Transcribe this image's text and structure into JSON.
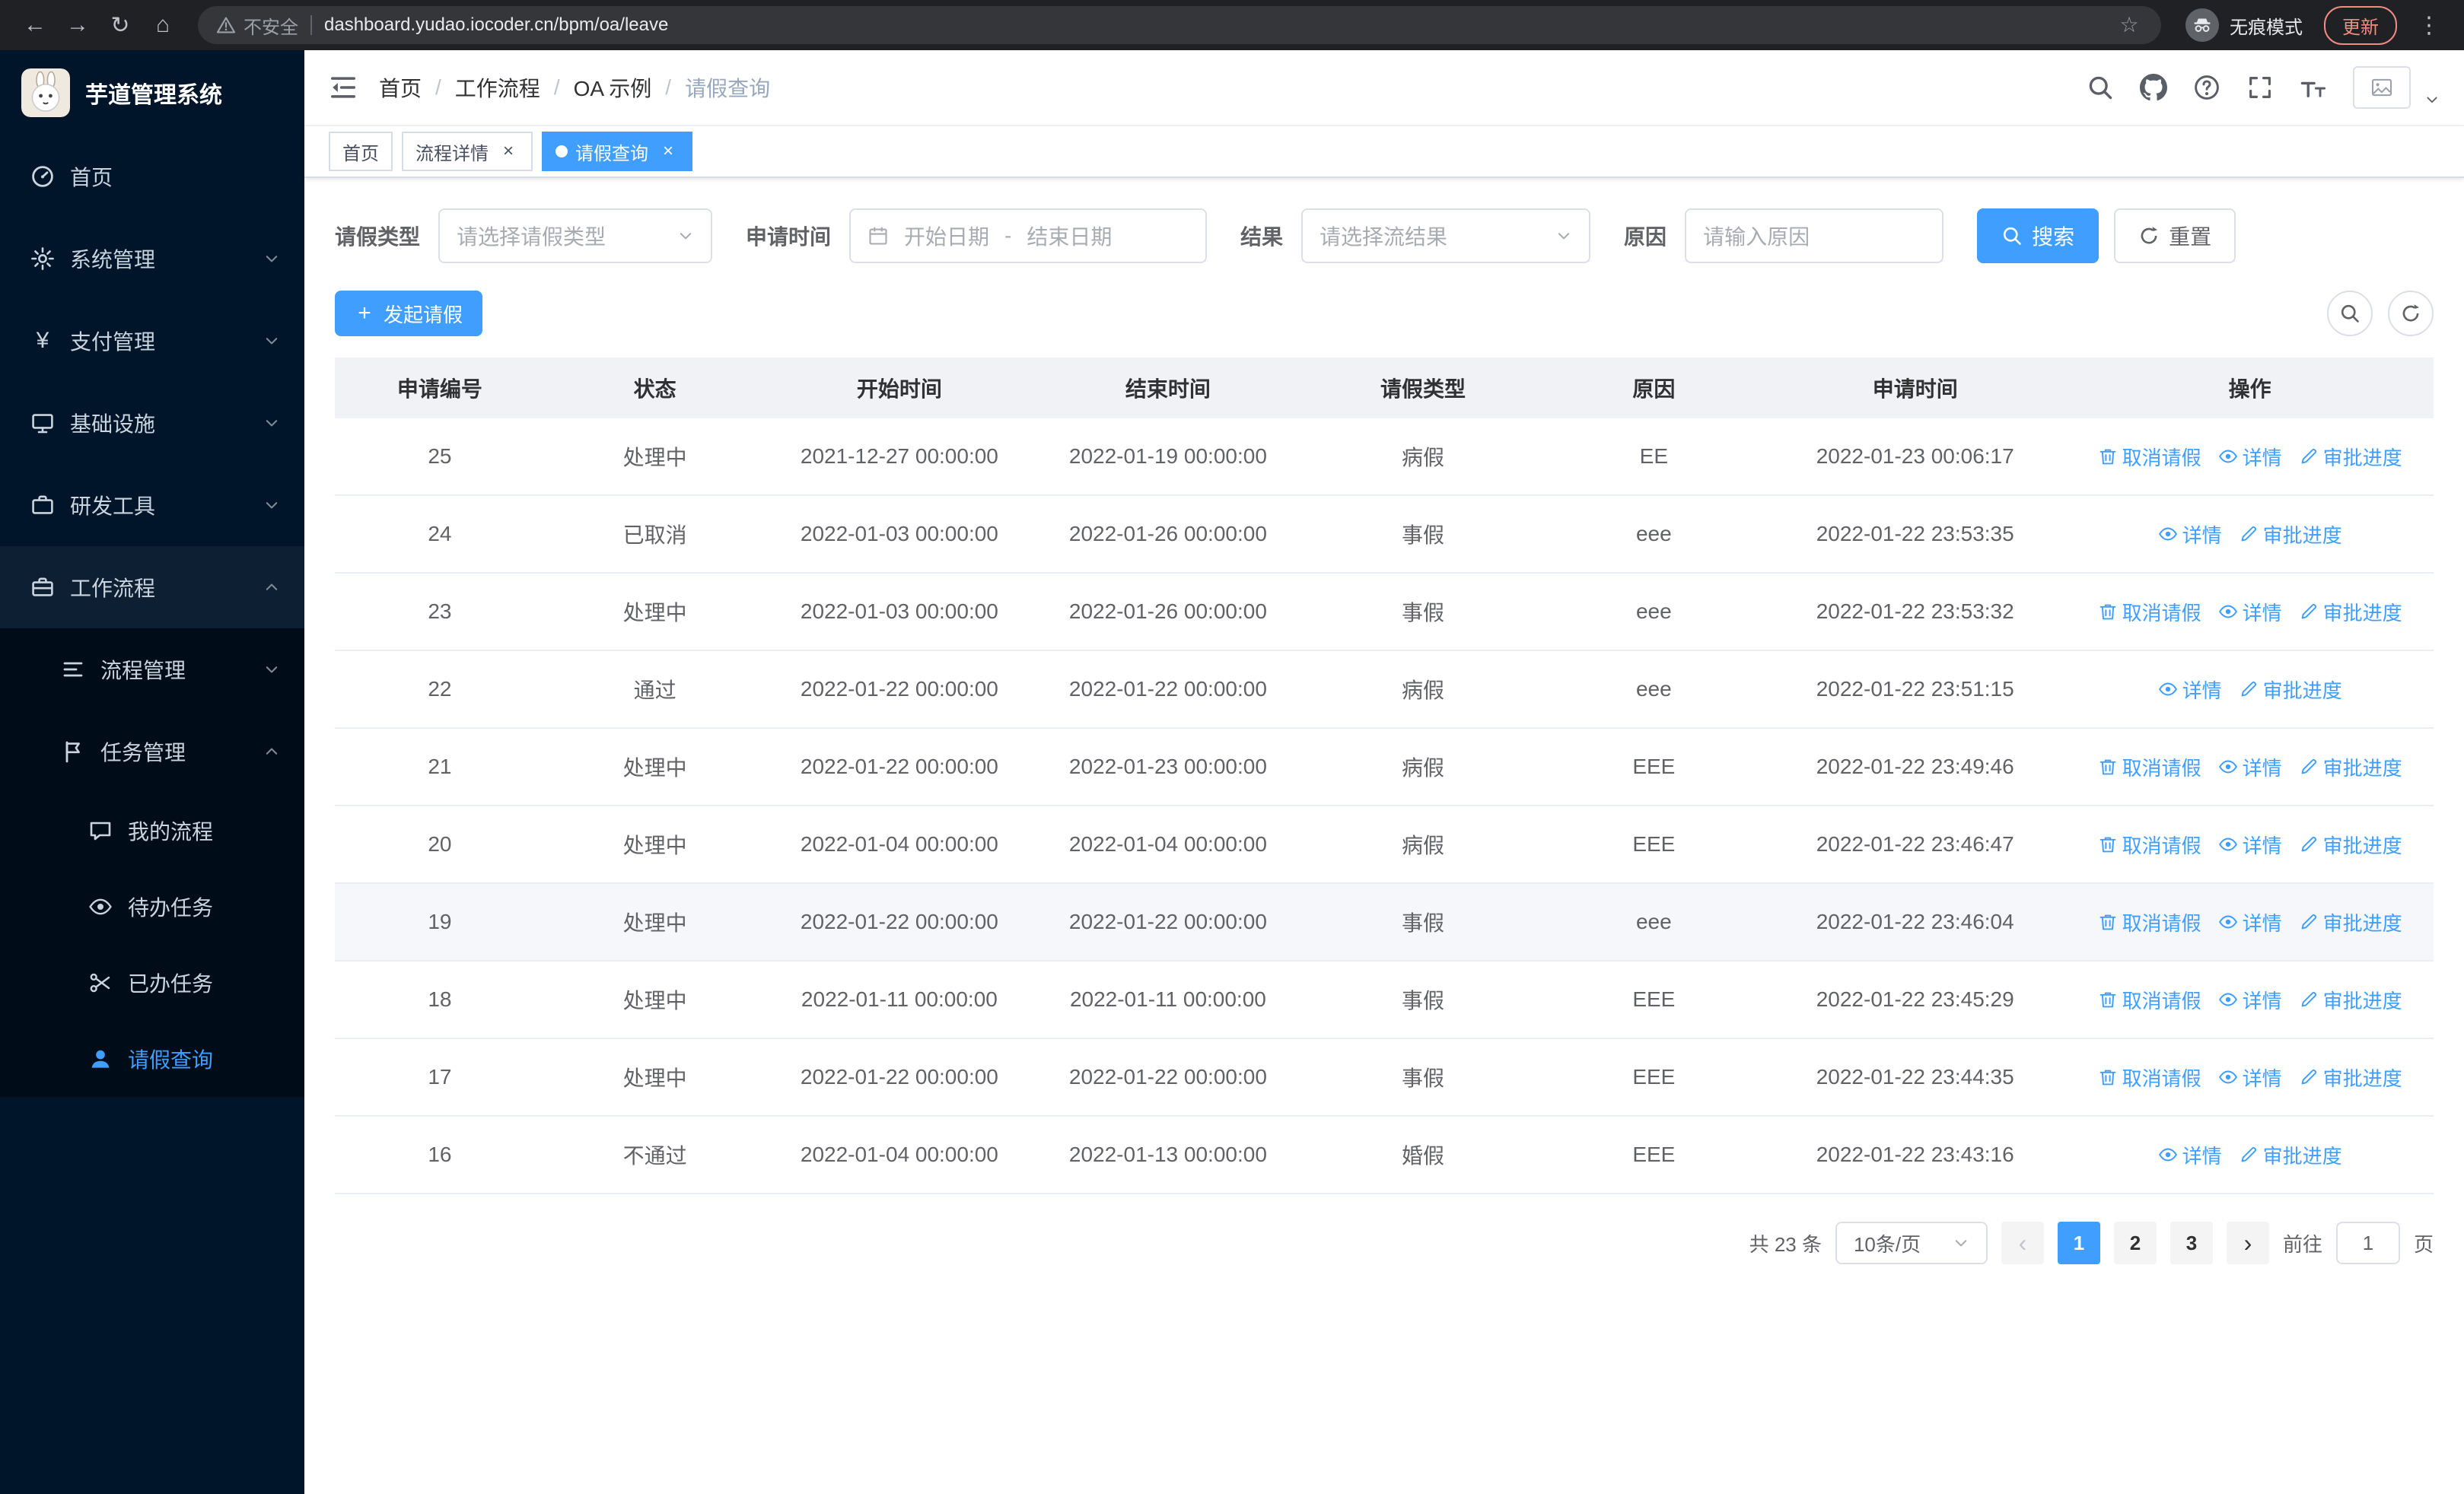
{
  "browser": {
    "security_warning": "不安全",
    "url": "dashboard.yudao.iocoder.cn/bpm/oa/leave",
    "incognito_label": "无痕模式",
    "update_label": "更新"
  },
  "sidebar": {
    "title": "芋道管理系统",
    "menu": [
      {
        "label": "首页",
        "icon": "dashboard",
        "level": 1
      },
      {
        "label": "系统管理",
        "icon": "gear",
        "level": 1,
        "arrow": "down"
      },
      {
        "label": "支付管理",
        "icon": "yen",
        "level": 1,
        "arrow": "down"
      },
      {
        "label": "基础设施",
        "icon": "monitor",
        "level": 1,
        "arrow": "down"
      },
      {
        "label": "研发工具",
        "icon": "toolbox",
        "level": 1,
        "arrow": "down"
      },
      {
        "label": "工作流程",
        "icon": "suitcase",
        "level": 1,
        "arrow": "up",
        "open": true
      },
      {
        "label": "流程管理",
        "icon": "stream",
        "level": 2,
        "arrow": "down"
      },
      {
        "label": "任务管理",
        "icon": "flag",
        "level": 2,
        "arrow": "up",
        "open": true
      },
      {
        "label": "我的流程",
        "icon": "chat",
        "level": 3
      },
      {
        "label": "待办任务",
        "icon": "eye",
        "level": 3
      },
      {
        "label": "已办任务",
        "icon": "scissors",
        "level": 3
      },
      {
        "label": "请假查询",
        "icon": "user",
        "level": 3,
        "active": true
      }
    ]
  },
  "header": {
    "breadcrumb": [
      "首页",
      "工作流程",
      "OA 示例",
      "请假查询"
    ]
  },
  "tabs": [
    {
      "label": "首页",
      "closable": false,
      "active": false
    },
    {
      "label": "流程详情",
      "closable": true,
      "active": false
    },
    {
      "label": "请假查询",
      "closable": true,
      "active": true
    }
  ],
  "filters": {
    "leave_type_label": "请假类型",
    "leave_type_placeholder": "请选择请假类型",
    "apply_time_label": "申请时间",
    "start_date_placeholder": "开始日期",
    "date_separator": "-",
    "end_date_placeholder": "结束日期",
    "result_label": "结果",
    "result_placeholder": "请选择流结果",
    "reason_label": "原因",
    "reason_placeholder": "请输入原因",
    "search_button": "搜索",
    "reset_button": "重置"
  },
  "toolbar": {
    "create_button": "发起请假"
  },
  "table": {
    "columns": [
      "申请编号",
      "状态",
      "开始时间",
      "结束时间",
      "请假类型",
      "原因",
      "申请时间",
      "操作"
    ],
    "action_labels": {
      "cancel": "取消请假",
      "detail": "详情",
      "progress": "审批进度"
    },
    "rows": [
      {
        "id": "25",
        "status": "处理中",
        "start": "2021-12-27 00:00:00",
        "end": "2022-01-19 00:00:00",
        "type": "病假",
        "reason": "EE",
        "applied": "2022-01-23 00:06:17",
        "actions": [
          "cancel",
          "detail",
          "progress"
        ]
      },
      {
        "id": "24",
        "status": "已取消",
        "start": "2022-01-03 00:00:00",
        "end": "2022-01-26 00:00:00",
        "type": "事假",
        "reason": "eee",
        "applied": "2022-01-22 23:53:35",
        "actions": [
          "detail",
          "progress"
        ]
      },
      {
        "id": "23",
        "status": "处理中",
        "start": "2022-01-03 00:00:00",
        "end": "2022-01-26 00:00:00",
        "type": "事假",
        "reason": "eee",
        "applied": "2022-01-22 23:53:32",
        "actions": [
          "cancel",
          "detail",
          "progress"
        ]
      },
      {
        "id": "22",
        "status": "通过",
        "start": "2022-01-22 00:00:00",
        "end": "2022-01-22 00:00:00",
        "type": "病假",
        "reason": "eee",
        "applied": "2022-01-22 23:51:15",
        "actions": [
          "detail",
          "progress"
        ]
      },
      {
        "id": "21",
        "status": "处理中",
        "start": "2022-01-22 00:00:00",
        "end": "2022-01-23 00:00:00",
        "type": "病假",
        "reason": "EEE",
        "applied": "2022-01-22 23:49:46",
        "actions": [
          "cancel",
          "detail",
          "progress"
        ]
      },
      {
        "id": "20",
        "status": "处理中",
        "start": "2022-01-04 00:00:00",
        "end": "2022-01-04 00:00:00",
        "type": "病假",
        "reason": "EEE",
        "applied": "2022-01-22 23:46:47",
        "actions": [
          "cancel",
          "detail",
          "progress"
        ]
      },
      {
        "id": "19",
        "status": "处理中",
        "start": "2022-01-22 00:00:00",
        "end": "2022-01-22 00:00:00",
        "type": "事假",
        "reason": "eee",
        "applied": "2022-01-22 23:46:04",
        "actions": [
          "cancel",
          "detail",
          "progress"
        ],
        "hover": true
      },
      {
        "id": "18",
        "status": "处理中",
        "start": "2022-01-11 00:00:00",
        "end": "2022-01-11 00:00:00",
        "type": "事假",
        "reason": "EEE",
        "applied": "2022-01-22 23:45:29",
        "actions": [
          "cancel",
          "detail",
          "progress"
        ]
      },
      {
        "id": "17",
        "status": "处理中",
        "start": "2022-01-22 00:00:00",
        "end": "2022-01-22 00:00:00",
        "type": "事假",
        "reason": "EEE",
        "applied": "2022-01-22 23:44:35",
        "actions": [
          "cancel",
          "detail",
          "progress"
        ]
      },
      {
        "id": "16",
        "status": "不通过",
        "start": "2022-01-04 00:00:00",
        "end": "2022-01-13 00:00:00",
        "type": "婚假",
        "reason": "EEE",
        "applied": "2022-01-22 23:43:16",
        "actions": [
          "detail",
          "progress"
        ]
      }
    ]
  },
  "pagination": {
    "total_text": "共 23 条",
    "page_size_text": "10条/页",
    "pages": [
      "1",
      "2",
      "3"
    ],
    "active_page": "1",
    "goto_prefix": "前往",
    "goto_value": "1",
    "goto_suffix": "页"
  },
  "colors": {
    "primary": "#409eff",
    "sidebar_bg": "#001529",
    "submenu_bg": "#000c17",
    "chrome_bg": "#202124",
    "table_header_bg": "#f0f2f5",
    "update_accent": "#f28b82"
  }
}
